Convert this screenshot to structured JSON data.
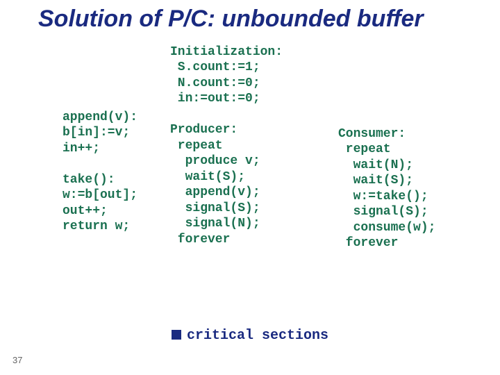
{
  "title": "Solution of P/C: unbounded buffer",
  "left": "append(v):\nb[in]:=v;\nin++;\n\ntake():\nw:=b[out];\nout++;\nreturn w;",
  "mid": "Initialization:\n S.count:=1;\n N.count:=0;\n in:=out:=0;\n\nProducer:\n repeat\n  produce v;\n  wait(S);\n  append(v);\n  signal(S);\n  signal(N);\n forever",
  "right": "Consumer:\n repeat\n  wait(N);\n  wait(S);\n  w:=take();\n  signal(S);\n  consume(w);\n forever",
  "footer": "critical sections",
  "page": "37"
}
